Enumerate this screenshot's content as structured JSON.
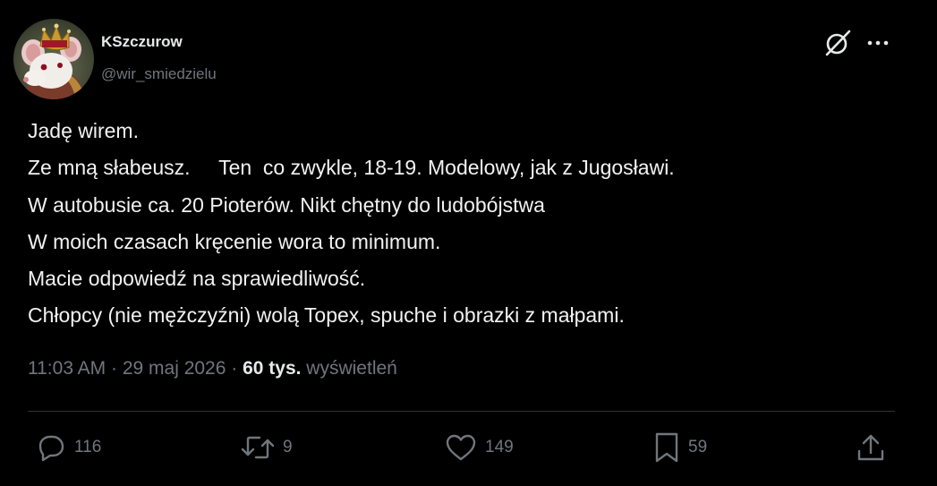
{
  "author": {
    "name": "KSzczurow",
    "handle": "@wir_smiedzielu"
  },
  "tweet_lines": [
    "Jadę wirem.",
    "Ze mną słabeusz.     Ten  co zwykle, 18-19. Modelowy, jak z Jugosławi.",
    "W autobusie ca. 20 Pioterów. Nikt chętny do ludobójstwa",
    "W moich czasach kręcenie wora to minimum.",
    "Macie odpowiedź na sprawiedliwość.",
    "Chłopcy (nie mężczyźni) wolą Topex, spuche i obrazki z małpami."
  ],
  "meta": {
    "timestamp": "11:03 AM · 29 maj 2026 · ",
    "views_count": "60 tys.",
    "views_label": " wyświetleń"
  },
  "actions": {
    "replies": "116",
    "retweets": "9",
    "likes": "149",
    "bookmarks": "59"
  },
  "icons": {
    "grok": "grok-icon",
    "more": "more-icon",
    "reply": "reply-icon",
    "retweet": "retweet-icon",
    "like": "heart-icon",
    "bookmark": "bookmark-icon",
    "share": "share-icon"
  },
  "colors": {
    "background": "#000000",
    "text_primary": "#e7e9ea",
    "text_secondary": "#71767b",
    "divider": "#2f3336"
  }
}
